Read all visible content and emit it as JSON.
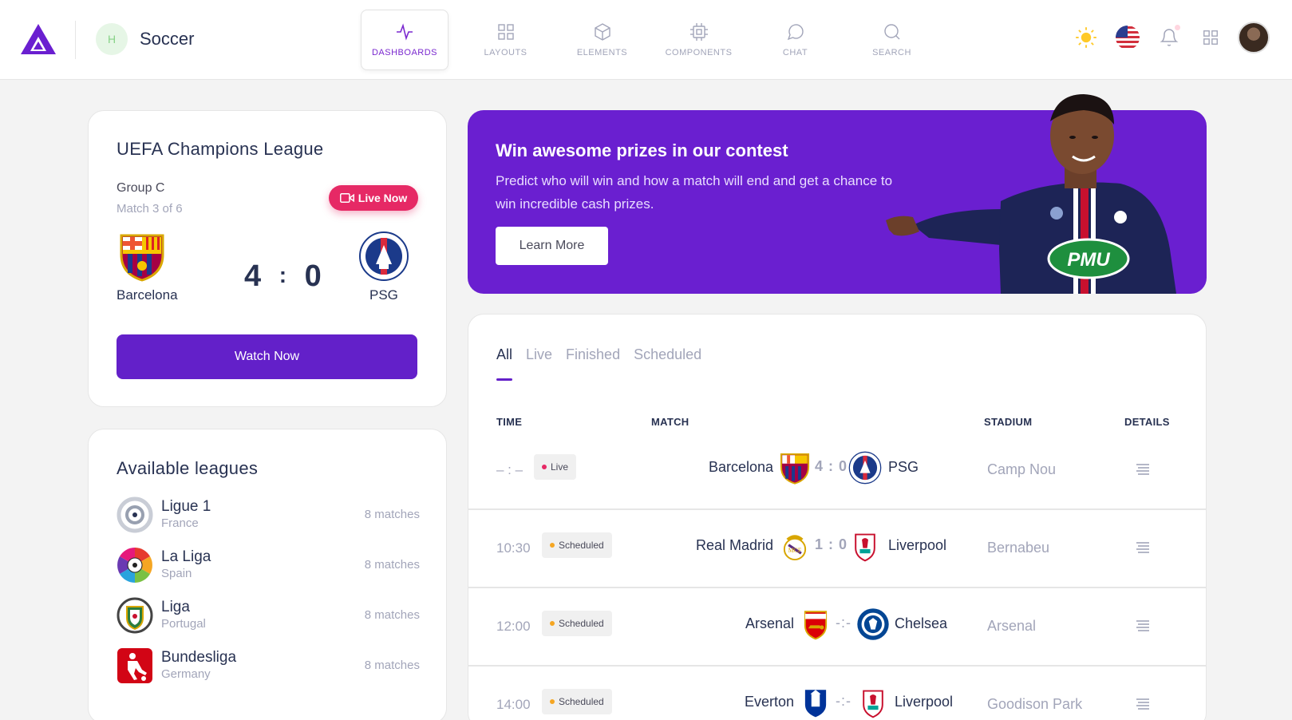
{
  "header": {
    "brand_initial": "H",
    "brand_title": "Soccer",
    "nav": [
      {
        "label": "DASHBOARDS",
        "icon": "activity-icon",
        "active": true
      },
      {
        "label": "LAYOUTS",
        "icon": "grid-icon",
        "active": false
      },
      {
        "label": "ELEMENTS",
        "icon": "box-icon",
        "active": false
      },
      {
        "label": "COMPONENTS",
        "icon": "cpu-icon",
        "active": false
      },
      {
        "label": "CHAT",
        "icon": "chat-icon",
        "active": false
      },
      {
        "label": "SEARCH",
        "icon": "search-icon",
        "active": false
      }
    ]
  },
  "featured_match": {
    "title": "UEFA Champions League",
    "group": "Group C",
    "match_label": "Match 3 of 6",
    "live_label": "Live Now",
    "home": "Barcelona",
    "away": "PSG",
    "home_score": "4",
    "away_score": "0",
    "watch_label": "Watch Now"
  },
  "leagues": {
    "title": "Available leagues",
    "items": [
      {
        "name": "Ligue 1",
        "country": "France",
        "count": "8 matches"
      },
      {
        "name": "La Liga",
        "country": "Spain",
        "count": "8 matches"
      },
      {
        "name": "Liga",
        "country": "Portugal",
        "count": "8 matches"
      },
      {
        "name": "Bundesliga",
        "country": "Germany",
        "count": "8 matches"
      }
    ]
  },
  "banner": {
    "title": "Win awesome prizes in our contest",
    "text": "Predict who will win and how a match will end and get a chance to win incredible cash prizes.",
    "button": "Learn More",
    "jersey_text": "PMU"
  },
  "matches": {
    "tabs": [
      "All",
      "Live",
      "Finished",
      "Scheduled"
    ],
    "headers": {
      "time": "TIME",
      "match": "MATCH",
      "stadium": "STADIUM",
      "details": "DETAILS"
    },
    "rows": [
      {
        "time": "– : –",
        "status": "Live",
        "home": "Barcelona",
        "away": "PSG",
        "score": "4 : 0",
        "stadium": "Camp Nou"
      },
      {
        "time": "10:30",
        "status": "Scheduled",
        "home": "Real Madrid",
        "away": "Liverpool",
        "score": "1 : 0",
        "stadium": "Bernabeu"
      },
      {
        "time": "12:00",
        "status": "Scheduled",
        "home": "Arsenal",
        "away": "Chelsea",
        "score": "-:-",
        "stadium": "Arsenal"
      },
      {
        "time": "14:00",
        "status": "Scheduled",
        "home": "Everton",
        "away": "Liverpool",
        "score": "-:-",
        "stadium": "Goodison Park"
      }
    ]
  },
  "colors": {
    "accent": "#6320c9",
    "live": "#e62965",
    "scheduled": "#f5a623"
  }
}
